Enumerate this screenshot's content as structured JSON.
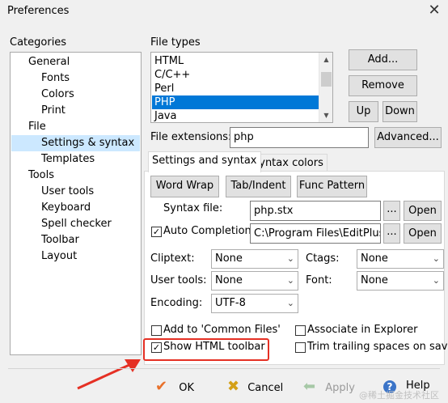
{
  "window": {
    "title": "Preferences",
    "close_glyph": "✕"
  },
  "categories": {
    "label": "Categories",
    "items": [
      {
        "label": "General"
      },
      {
        "label": "Fonts"
      },
      {
        "label": "Colors"
      },
      {
        "label": "Print"
      },
      {
        "label": "File"
      },
      {
        "label": "Settings & syntax"
      },
      {
        "label": "Templates"
      },
      {
        "label": "Tools"
      },
      {
        "label": "User tools"
      },
      {
        "label": "Keyboard"
      },
      {
        "label": "Spell checker"
      },
      {
        "label": "Toolbar"
      },
      {
        "label": "Layout"
      }
    ],
    "selected": "Settings & syntax"
  },
  "file_types": {
    "label": "File types",
    "items": [
      "HTML",
      "C/C++",
      "Perl",
      "PHP",
      "Java"
    ],
    "selected": "PHP",
    "add_button": "Add...",
    "remove_button": "Remove",
    "up_button": "Up",
    "down_button": "Down"
  },
  "file_extensions": {
    "label": "File extensions:",
    "value": "php",
    "advanced_button": "Advanced..."
  },
  "tabs": [
    "Settings and syntax",
    "Syntax colors"
  ],
  "settings": {
    "word_wrap_button": "Word Wrap",
    "tab_indent_button": "Tab/Indent",
    "func_pattern_button": "Func Pattern",
    "syntax_file_label": "Syntax file:",
    "syntax_file_value": "php.stx",
    "browse_glyph": "...",
    "open_button": "Open",
    "auto_completion_label": "Auto Completion:",
    "auto_completion_checked": true,
    "auto_completion_value": "C:\\Program Files\\EditPlus\\p",
    "cliptext_label": "Cliptext:",
    "cliptext_value": "None",
    "ctags_label": "Ctags:",
    "ctags_value": "None",
    "user_tools_label": "User tools:",
    "user_tools_value": "None",
    "font_label": "Font:",
    "font_value": "None",
    "encoding_label": "Encoding:",
    "encoding_value": "UTF-8",
    "add_common_files_label": "Add to 'Common Files'",
    "add_common_files_checked": false,
    "associate_explorer_label": "Associate in Explorer",
    "associate_explorer_checked": false,
    "show_html_toolbar_label": "Show HTML toolbar",
    "show_html_toolbar_checked": true,
    "trim_trailing_label": "Trim trailing spaces on save",
    "trim_trailing_checked": false,
    "check_glyph": "✓"
  },
  "footer": {
    "ok_button": "OK",
    "cancel_button": "Cancel",
    "apply_button": "Apply",
    "help_button": "Help",
    "watermark": "@稀土掘金技术社区"
  },
  "colors": {
    "selection_blue": "#0078d7",
    "tree_selection": "#cce8ff",
    "annotation_red": "#e53024"
  }
}
